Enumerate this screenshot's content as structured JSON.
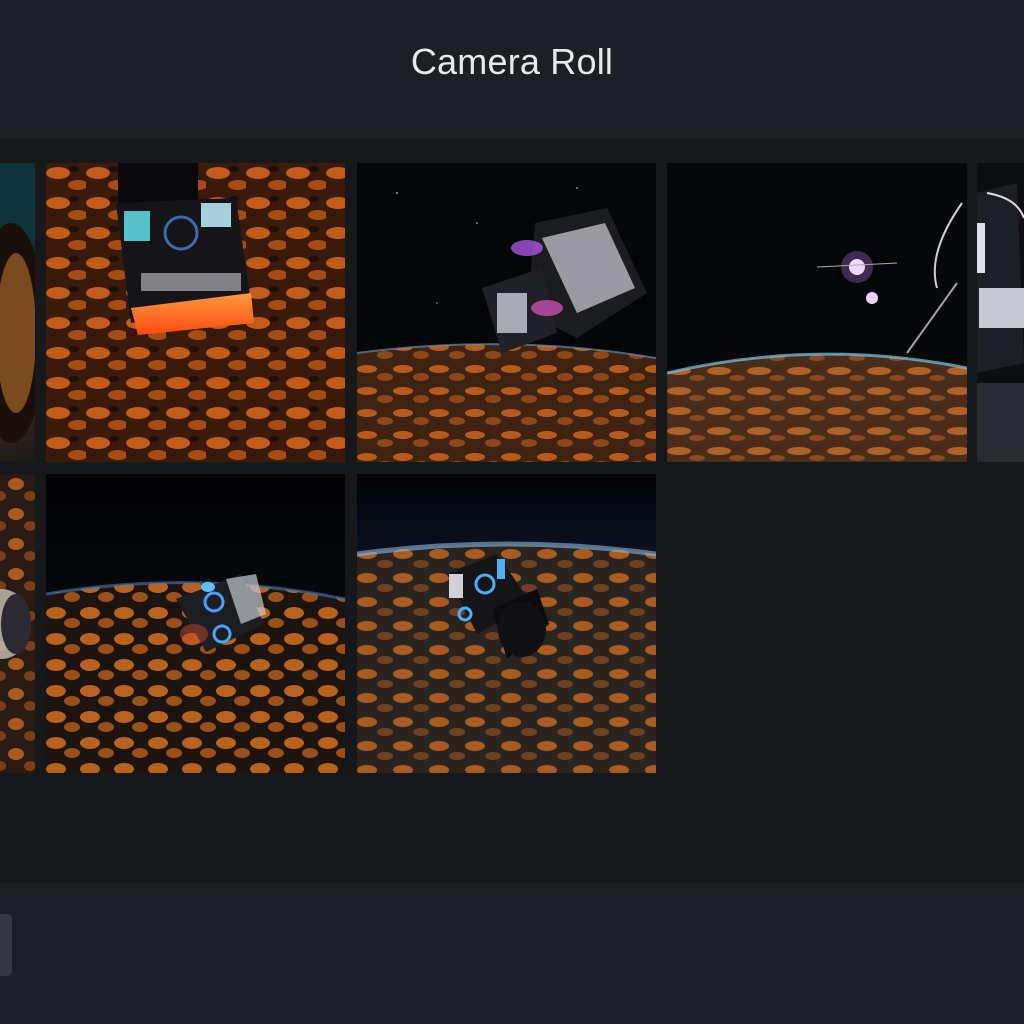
{
  "header": {
    "title": "Camera Roll"
  },
  "gallery": {
    "photos": [
      {
        "scene": "partial-capsule-edge"
      },
      {
        "scene": "capsule-top-down-glowing-heat-shield"
      },
      {
        "scene": "capsule-above-planet-horizon"
      },
      {
        "scene": "distant-station-over-planet"
      },
      {
        "scene": "partial-station-closeup"
      },
      {
        "scene": "partial-planet-edge"
      },
      {
        "scene": "capsule-blue-lights-over-planet"
      },
      {
        "scene": "capsule-orbiting-planet"
      }
    ]
  },
  "colors": {
    "header_bg": "#1c1f24",
    "grid_bg": "#17181a",
    "footer_bg": "#1c1f24",
    "title_text": "#e8e9ea"
  }
}
